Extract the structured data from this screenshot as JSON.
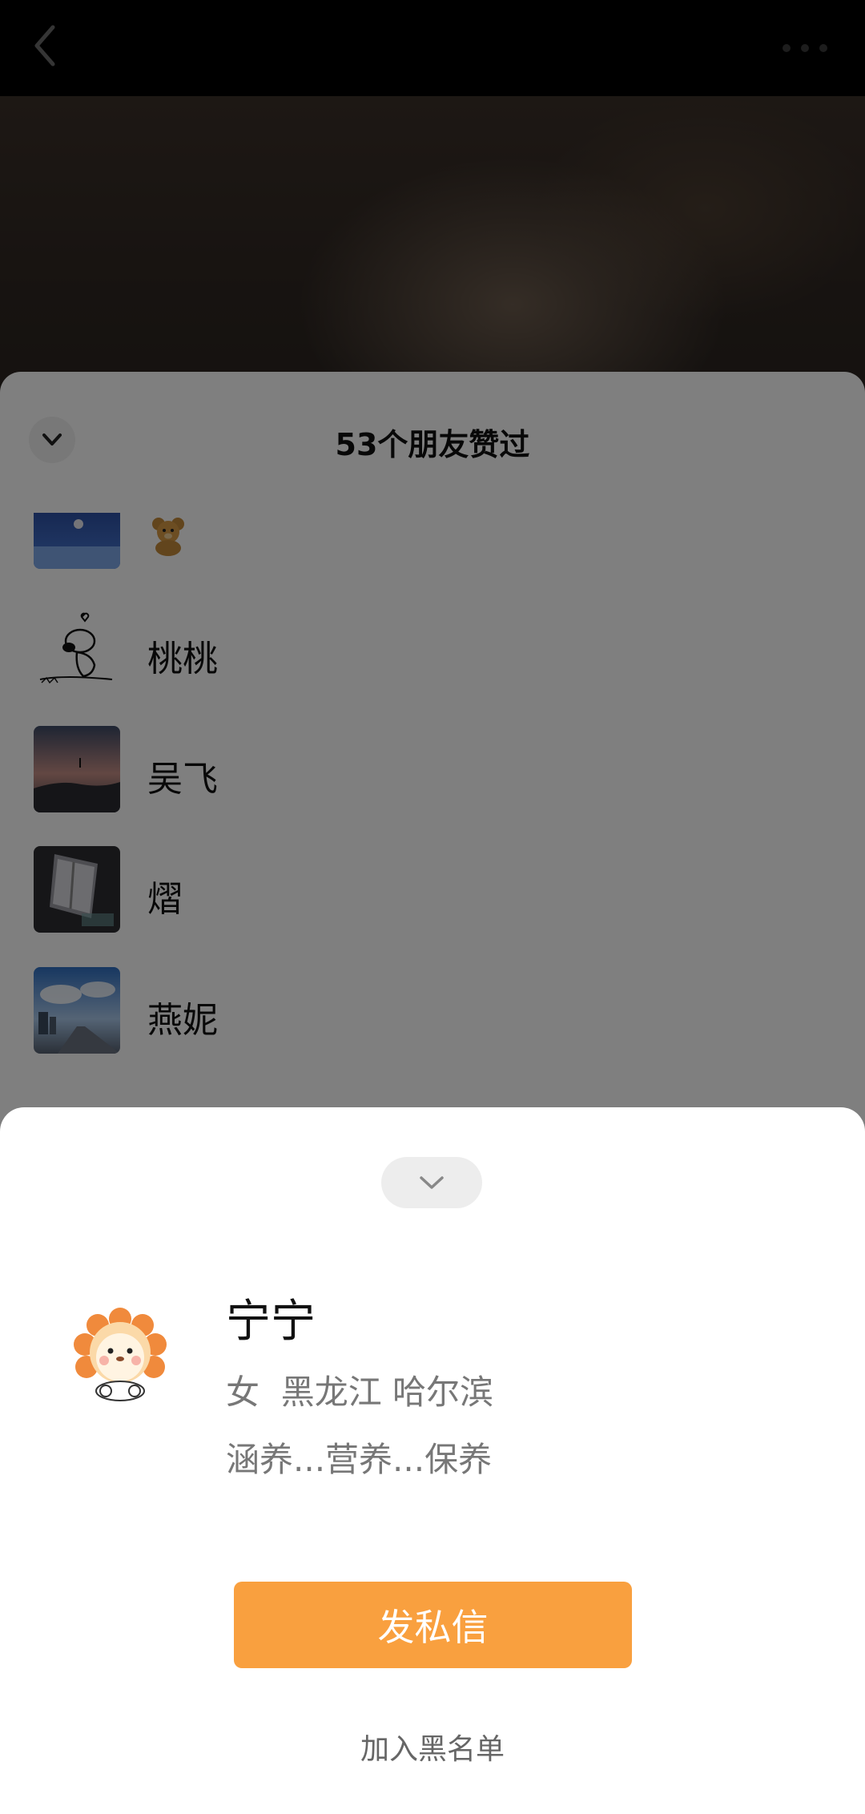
{
  "likes": {
    "title": "53个朋友赞过",
    "friends": [
      {
        "name": "",
        "avatar": "night-sky-photo",
        "extra": "teddy-bear-emoji"
      },
      {
        "name": "桃桃",
        "avatar": "snoopy-sketch"
      },
      {
        "name": "吴飞",
        "avatar": "dusk-mountain-photo"
      },
      {
        "name": "熠",
        "avatar": "window-light-photo"
      },
      {
        "name": "燕妮",
        "avatar": "blue-sky-city-photo"
      }
    ]
  },
  "profile": {
    "name": "宁宁",
    "gender": "女",
    "location": "黑龙江 哈尔滨",
    "meta": "女  黑龙江 哈尔滨",
    "bio": "涵养...营养...保养",
    "avatar": "lion-cartoon"
  },
  "actions": {
    "message_label": "发私信",
    "blacklist_label": "加入黑名单"
  },
  "colors": {
    "accent": "#f9a03f",
    "overlay": "rgba(0,0,0,0.5)"
  }
}
